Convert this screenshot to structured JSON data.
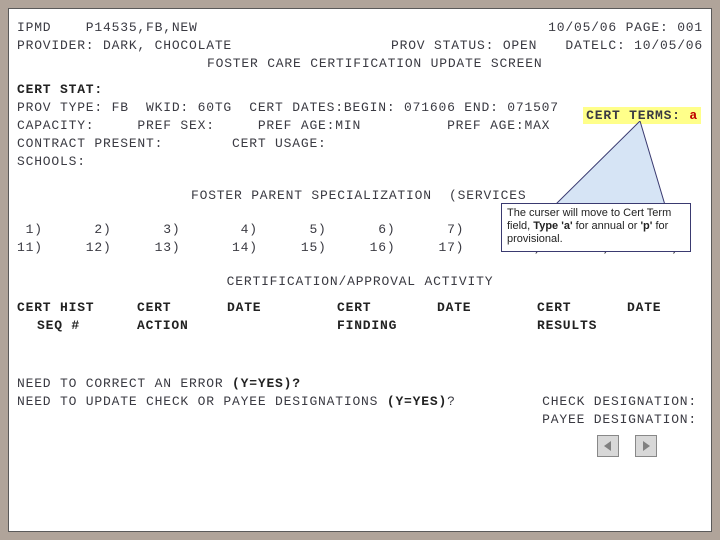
{
  "header": {
    "l1_left": "IPMD    P14535,FB,NEW",
    "l1_right": "10/05/06 PAGE: 001",
    "l2_left": "PROVIDER: DARK, CHOCOLATE",
    "l2_mid": "PROV STATUS: OPEN",
    "l2_right": "DATELC: 10/05/06",
    "title": "FOSTER CARE CERTIFICATION UPDATE SCREEN"
  },
  "cert": {
    "stat_label": "CERT STAT:",
    "line_provtype": "PROV TYPE: FB  WKID: 60TG  CERT DATES:BEGIN: 071606 END: 071507",
    "highlight_label": "CERT TERMS:",
    "highlight_value": "a",
    "line_capacity": "CAPACITY:     PREF SEX:     PREF AGE:MIN          PREF AGE:MAX",
    "line_contract": "CONTRACT PRESENT:        CERT USAGE:",
    "line_schools": "SCHOOLS:"
  },
  "spec": {
    "title_left": "FOSTER PARENT SPECIALIZATION  (SERVICES ",
    "row1": " 1)      2)      3)       4)      5)      6)      7)       8)      9)     10)",
    "row2": "11)     12)     13)      14)     15)     16)     17)      18)     19)     20)"
  },
  "activity": {
    "title": "CERTIFICATION/APPROVAL ACTIVITY",
    "hdr1_a": "CERT HIST",
    "hdr1_b": "CERT",
    "hdr1_c": "DATE",
    "hdr1_d": "CERT",
    "hdr1_e": "DATE",
    "hdr1_f": "CERT",
    "hdr1_g": "DATE",
    "hdr2_a": "SEQ #",
    "hdr2_b": "ACTION",
    "hdr2_c": "FINDING",
    "hdr2_d": "RESULTS"
  },
  "footer": {
    "q1_left": "NEED TO CORRECT AN ERROR ",
    "q1_paren": "(Y=YES)?",
    "q2_left": "NEED TO UPDATE CHECK OR PAYEE DESIGNATIONS ",
    "q2_paren": "(Y=YES)",
    "q2_after": "?",
    "check_desig": "CHECK DESIGNATION:",
    "payee_desig": "PAYEE DESIGNATION:"
  },
  "callout": {
    "t1": "The curser will move to  Cert Term field, ",
    "b1": "Type 'a'",
    "t2": " for annual or ",
    "b2": "'p'",
    "t3": " for provisional."
  },
  "nav": {
    "prev": "prev",
    "next": "next"
  }
}
